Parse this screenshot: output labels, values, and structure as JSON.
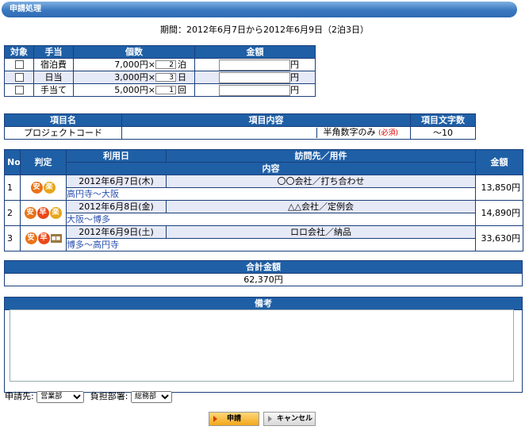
{
  "title": "申請処理",
  "period": "期間：2012年6月7日から2012年6月9日（2泊3日）",
  "allowance": {
    "headers": [
      "対象",
      "手当",
      "個数",
      "金額"
    ],
    "rows": [
      {
        "name": "宿泊費",
        "unit_price": "7,000円×",
        "qty": "2",
        "unit": "泊",
        "yen": "円"
      },
      {
        "name": "日当",
        "unit_price": "3,000円×",
        "qty": "3",
        "unit": "日",
        "yen": "円"
      },
      {
        "name": "手当て",
        "unit_price": "5,000円×",
        "qty": "1",
        "unit": "回",
        "yen": "円"
      }
    ]
  },
  "item": {
    "headers": [
      "項目名",
      "項目内容",
      "項目文字数"
    ],
    "name": "プロジェクトコード",
    "hint": "半角数字のみ",
    "required": "(必須)",
    "length": "～10"
  },
  "trips": {
    "headers": {
      "no": "No",
      "judge": "判定",
      "date": "利用日",
      "visit": "訪問先／用件",
      "detail": "内容",
      "amount": "金額"
    },
    "badges": {
      "an": "安",
      "haya": "早",
      "raku": "楽",
      "sq": "■■"
    },
    "rows": [
      {
        "no": "1",
        "date": "2012年6月7日(木)",
        "visit": "〇〇会社／打ち合わせ",
        "route": "高円寺～大阪",
        "amount": "13,850円"
      },
      {
        "no": "2",
        "date": "2012年6月8日(金)",
        "visit": "△△会社／定例会",
        "route": "大阪～博多",
        "amount": "14,890円"
      },
      {
        "no": "3",
        "date": "2012年6月9日(土)",
        "visit": "ロロ会社／納品",
        "route": "博多～高円寺",
        "amount": "33,630円"
      }
    ]
  },
  "total": {
    "header": "合計金額",
    "value": "62,370円"
  },
  "remarks": {
    "header": "備考"
  },
  "footer": {
    "applicant_label": "申請先:",
    "applicant_value": "営業部",
    "dept_label": "負担部署:",
    "dept_value": "総務部",
    "apply_button": "申請",
    "cancel_button": "キャンセル"
  }
}
